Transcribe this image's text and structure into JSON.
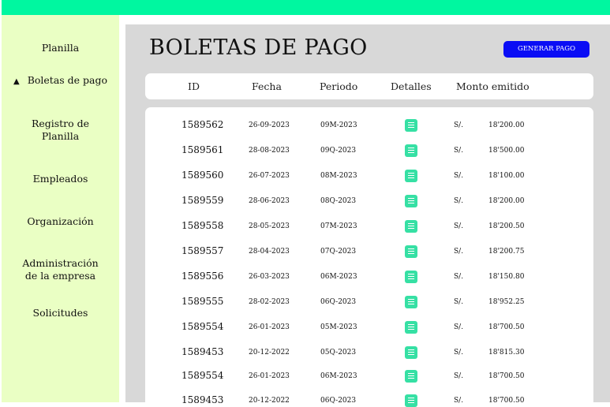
{
  "sidebar": {
    "items": [
      {
        "label": "Planilla"
      },
      {
        "label": "Boletas de pago",
        "active": true,
        "marker": "▲"
      },
      {
        "label_lines": [
          "Registro de",
          "Planilla"
        ]
      },
      {
        "label": "Empleados"
      },
      {
        "label": "Organización"
      },
      {
        "label_lines": [
          "Administración",
          "de la empresa"
        ]
      },
      {
        "label": "Solicitudes"
      }
    ]
  },
  "main": {
    "title": "BOLETAS DE PAGO",
    "generate_button": "GENERAR PAGO",
    "columns": [
      "ID",
      "Fecha",
      "Periodo",
      "Detalles",
      "Monto emitido"
    ],
    "rows": [
      {
        "id": "1589562",
        "fecha": "26-09-2023",
        "periodo": "09M-2023",
        "currency": "S/.",
        "monto": "18'200.00"
      },
      {
        "id": "1589561",
        "fecha": "28-08-2023",
        "periodo": "09Q-2023",
        "currency": "S/.",
        "monto": "18'500.00"
      },
      {
        "id": "1589560",
        "fecha": "26-07-2023",
        "periodo": "08M-2023",
        "currency": "S/.",
        "monto": "18'100.00"
      },
      {
        "id": "1589559",
        "fecha": "28-06-2023",
        "periodo": "08Q-2023",
        "currency": "S/.",
        "monto": "18'200.00"
      },
      {
        "id": "1589558",
        "fecha": "28-05-2023",
        "periodo": "07M-2023",
        "currency": "S/.",
        "monto": "18'200.50"
      },
      {
        "id": "1589557",
        "fecha": "28-04-2023",
        "periodo": "07Q-2023",
        "currency": "S/.",
        "monto": "18'200.75"
      },
      {
        "id": "1589556",
        "fecha": "26-03-2023",
        "periodo": "06M-2023",
        "currency": "S/.",
        "monto": "18'150.80"
      },
      {
        "id": "1589555",
        "fecha": "28-02-2023",
        "periodo": "06Q-2023",
        "currency": "S/.",
        "monto": "18'952.25"
      },
      {
        "id": "1589554",
        "fecha": "26-01-2023",
        "periodo": "05M-2023",
        "currency": "S/.",
        "monto": "18'700.50"
      },
      {
        "id": "1589453",
        "fecha": "20-12-2022",
        "periodo": "05Q-2023",
        "currency": "S/.",
        "monto": "18'815.30"
      },
      {
        "id": "1589554",
        "fecha": "26-01-2023",
        "periodo": "06M-2023",
        "currency": "S/.",
        "monto": "18'700.50"
      },
      {
        "id": "1589453",
        "fecha": "20-12-2022",
        "periodo": "06Q-2023",
        "currency": "S/.",
        "monto": "18'700.50"
      }
    ]
  },
  "colors": {
    "topbar": "#00f7a0",
    "sidebar": "#eaffc4",
    "button": "#0a0df5",
    "detail_icon": "#36e0a4"
  },
  "icons": {
    "detail": "document-icon",
    "active_marker": "triangle-up-icon"
  }
}
